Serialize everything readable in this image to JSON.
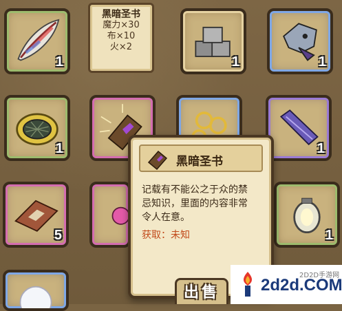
{
  "recipe": {
    "title": "黑暗圣书",
    "ingredients": [
      "魔力×30",
      "布×10",
      "火×2"
    ]
  },
  "slots": [
    {
      "name": "feather",
      "count": "1"
    },
    {
      "name": "stones",
      "count": "1"
    },
    {
      "name": "dragon-helmet",
      "count": "1"
    },
    {
      "name": "nest",
      "count": "1"
    },
    {
      "name": "dark-book",
      "count": ""
    },
    {
      "name": "gold-rings",
      "count": ""
    },
    {
      "name": "crystal-bar",
      "count": "1"
    },
    {
      "name": "leather-scroll",
      "count": "5"
    },
    {
      "name": "lantern",
      "count": "1"
    }
  ],
  "tooltip": {
    "name": "黑暗圣书",
    "description_lines": [
      "记载有不能公之于众的禁",
      "忌知识，里面的内容非常",
      "令人在意。"
    ],
    "source": "获取：未知"
  },
  "sell_button": "出售",
  "watermark": {
    "text": "2d2d.COM",
    "sub": "2D2D手游网"
  }
}
